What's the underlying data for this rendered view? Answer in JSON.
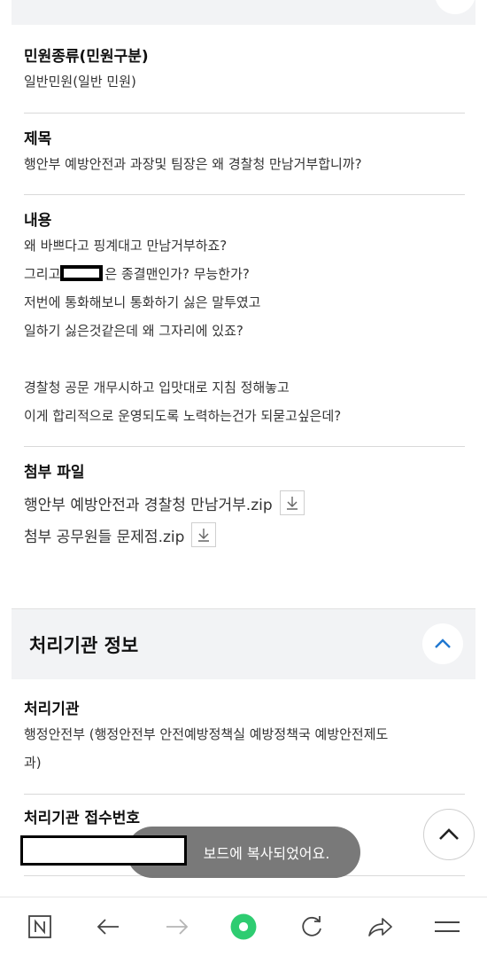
{
  "fields": {
    "complaint_type": {
      "label": "민원종류(민원구분)",
      "value": "일반민원(일반 민원)"
    },
    "subject": {
      "label": "제목",
      "value": "행안부 예방안전과 과장및 팀장은 왜 경찰청 만남거부합니까?"
    },
    "content": {
      "label": "내용",
      "lines": [
        "왜 바쁘다고 핑계대고 만남거부하죠?",
        "그리고",
        "은 종결맨인가? 무능한가?",
        "저번에 통화해보니 통화하기 싫은 말투였고",
        "일하기 싫은것같은데 왜 그자리에 있죠?",
        "경찰청 공문 개무시하고 입맛대로 지침 정해놓고",
        "이게 합리적으로 운영되도록  노력하는건가 되묻고싶은데?"
      ]
    },
    "attachments": {
      "label": "첨부 파일",
      "files": [
        "행안부 예방안전과 경찰청 만남거부.zip",
        "첨부 공무원들 문제점.zip"
      ]
    }
  },
  "agency_section": {
    "title": "처리기관 정보",
    "agency": {
      "label": "처리기관",
      "value_line1": "행정안전부 (행정안전부 안전예방정책실 예방정책국 예방안전제도",
      "value_line2": "과)"
    },
    "receipt_number": {
      "label": "처리기관 접수번호"
    }
  },
  "toast": {
    "text": "보드에 복사되었어요."
  },
  "icons": {
    "download": "download-arrow-icon",
    "collapse": "chevron-up-icon",
    "scroll_top": "chevron-up-icon",
    "home": "naver-n-icon",
    "back": "arrow-left-icon",
    "forward": "arrow-right-icon",
    "green": "green-circle-icon",
    "refresh": "refresh-icon",
    "share": "share-icon",
    "menu": "hamburger-icon"
  },
  "colors": {
    "accent_blue": "#1f78d1",
    "green": "#2ecc71",
    "section_bg": "#f2f3f5"
  }
}
